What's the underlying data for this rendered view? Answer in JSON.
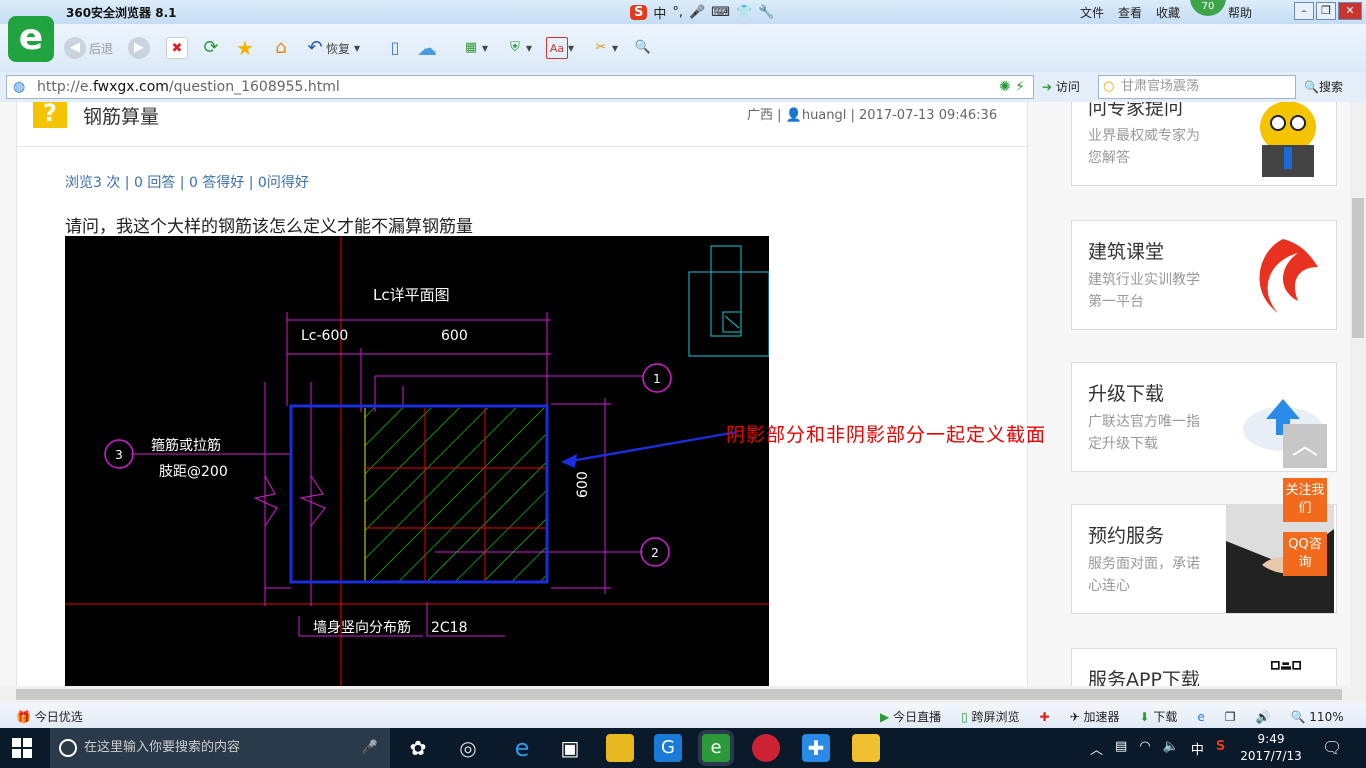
{
  "window": {
    "title": "360安全浏览器 8.1",
    "ime": [
      "中",
      "°,"
    ],
    "menu": [
      "文件",
      "查看",
      "收藏",
      "帮助"
    ],
    "badge": "70"
  },
  "toolbar": {
    "back": "后退",
    "restore": "恢复"
  },
  "address": {
    "url_prefix": "http://e.",
    "url_domain": "fwxgx.com",
    "url_path": "/question_1608955.html",
    "go": "访问",
    "search_placeholder": "甘肃官场震荡",
    "search_btn": "搜索"
  },
  "question": {
    "title": "钢筋算量",
    "meta": "广西 | 👤huangl | 2017-07-13 09:46:36",
    "stats": "浏览3 次 | 0 回答 | 0 答得好 | 0问得好",
    "text": "请问，我这个大样的钢筋该怎么定义才能不漏算钢筋量",
    "annotation": "阴影部分和非阴影部分一起定义截面"
  },
  "cad": {
    "title": "Lc详平面图",
    "dim_left": "Lc-600",
    "dim_right": "600",
    "dim_vert": "600",
    "label_stirrup": "箍筋或拉筋",
    "label_spacing": "肢距@200",
    "label_wall": "墙身竖向分布筋",
    "label_bar": "2C18",
    "callouts": [
      "1",
      "2",
      "3"
    ]
  },
  "sidebar": {
    "cards": [
      {
        "title": "问专家提问",
        "sub": "业界最权威专家为您解答"
      },
      {
        "title": "建筑课堂",
        "sub": "建筑行业实训教学第一平台"
      },
      {
        "title": "升级下载",
        "sub": "广联达官方唯一指定升级下载"
      },
      {
        "title": "预约服务",
        "sub": "服务面对面，承诺心连心"
      },
      {
        "title": "服务APP下载",
        "sub": ""
      }
    ],
    "follow": "关注我们",
    "qq": "QQ咨询"
  },
  "statusbar": {
    "left": "今日优选",
    "items": [
      "今日直播",
      "跨屏浏览",
      "加速器",
      "下载"
    ],
    "zoom": "110%"
  },
  "taskbar": {
    "search": "在这里输入你要搜索的内容",
    "time": "9:49",
    "date": "2017/7/13",
    "ime": "中"
  },
  "colors": {
    "accent": "#21a33f",
    "annotation": "#e00000",
    "link": "#3b6fb0"
  }
}
